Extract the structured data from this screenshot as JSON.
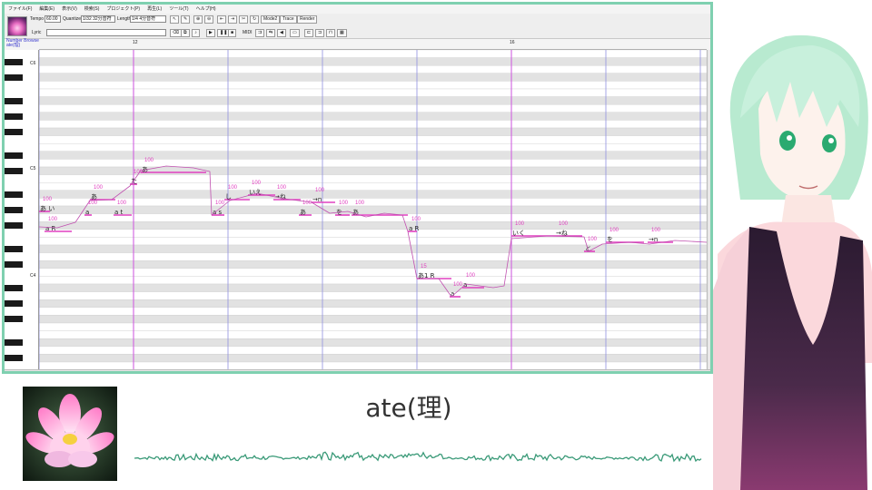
{
  "editor": {
    "menu": [
      "ファイル(F)",
      "編集(E)",
      "表示(V)",
      "検索(S)",
      "プロジェクト(P)",
      "再生(L)",
      "ツール(T)",
      "ヘルプ(H)"
    ],
    "toolbar": {
      "tempo_label": "Tempo",
      "tempo_value": "60.00",
      "quantize_label": "Quantize",
      "quantize_value": "1/32 32分音符",
      "length_label": "Length",
      "length_value": "1/4 4分音符",
      "lyric_label": "Lyric",
      "midi_label": "MIDI",
      "mode2_label": "Mode2",
      "trace_label": "Trace",
      "render_label": "Render"
    },
    "header_box": [
      "Number Browse",
      "ate(理)"
    ],
    "ruler": [
      "12",
      "16"
    ],
    "octaves": [
      "C6",
      "C5",
      "C4"
    ],
    "notes": [
      {
        "lyric": "あ い",
        "dyn": "100"
      },
      {
        "lyric": "a R",
        "dyn": "100"
      },
      {
        "lyric": "a",
        "dyn": "100"
      },
      {
        "lyric": "あ",
        "dyn": "100"
      },
      {
        "lyric": "a t",
        "dyn": "100"
      },
      {
        "lyric": "た",
        "dyn": "100"
      },
      {
        "lyric": "あ",
        "dyn": "100"
      },
      {
        "lyric": "a s",
        "dyn": "100"
      },
      {
        "lyric": "し",
        "dyn": "100"
      },
      {
        "lyric": "いえ",
        "dyn": "100"
      },
      {
        "lyric": "→ね",
        "dyn": "100"
      },
      {
        "lyric": "あ",
        "dyn": "100"
      },
      {
        "lyric": "→n",
        "dyn": "100"
      },
      {
        "lyric": "を",
        "dyn": "100"
      },
      {
        "lyric": "あ",
        "dyn": "100"
      },
      {
        "lyric": "a R",
        "dyn": "100"
      },
      {
        "lyric": "あ1 R",
        "dyn": "15"
      },
      {
        "lyric": "a",
        "dyn": "100"
      },
      {
        "lyric": "a",
        "dyn": "100"
      },
      {
        "lyric": "いく",
        "dyn": "100"
      },
      {
        "lyric": "→ね",
        "dyn": "100"
      },
      {
        "lyric": "と",
        "dyn": "100"
      },
      {
        "lyric": "を",
        "dyn": "100"
      },
      {
        "lyric": "→n",
        "dyn": "100"
      }
    ]
  },
  "track": {
    "title": "ate(理)"
  },
  "colors": {
    "frame": "#7fd0b0",
    "note": "#e040c0",
    "pitch": "#c050b0",
    "waveform": "#3a9a78",
    "measure_line": "#d060e0",
    "beat_line": "#9090e0"
  }
}
